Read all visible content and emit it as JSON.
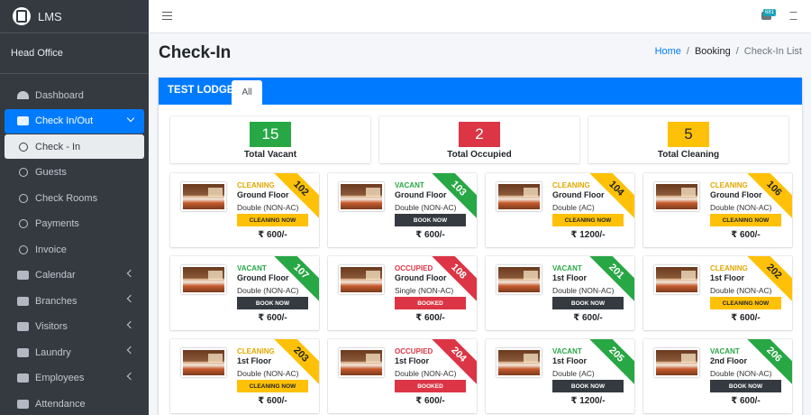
{
  "brand": {
    "name": "LMS"
  },
  "user": {
    "name": "Head Office"
  },
  "nav": [
    {
      "label": "Dashboard",
      "icon": "dashboard-icon",
      "kind": "dash",
      "chevron": false,
      "state": ""
    },
    {
      "label": "Check In/Out",
      "icon": "cart-icon",
      "kind": "cart",
      "chevron": true,
      "state": "active"
    },
    {
      "label": "Check - In",
      "icon": "circle-icon",
      "kind": "circle",
      "chevron": false,
      "state": "sub-active"
    },
    {
      "label": "Guests",
      "icon": "circle-icon",
      "kind": "circle",
      "chevron": false,
      "state": ""
    },
    {
      "label": "Check Rooms",
      "icon": "circle-icon",
      "kind": "circle",
      "chevron": false,
      "state": ""
    },
    {
      "label": "Payments",
      "icon": "circle-icon",
      "kind": "circle",
      "chevron": false,
      "state": ""
    },
    {
      "label": "Invoice",
      "icon": "circle-icon",
      "kind": "circle",
      "chevron": false,
      "state": ""
    },
    {
      "label": "Calendar",
      "icon": "calendar-icon",
      "kind": "box",
      "chevron": true,
      "state": ""
    },
    {
      "label": "Branches",
      "icon": "briefcase-icon",
      "kind": "box",
      "chevron": true,
      "state": ""
    },
    {
      "label": "Visitors",
      "icon": "edit-icon",
      "kind": "box",
      "chevron": true,
      "state": ""
    },
    {
      "label": "Laundry",
      "icon": "list-icon",
      "kind": "box",
      "chevron": true,
      "state": ""
    },
    {
      "label": "Employees",
      "icon": "users-icon",
      "kind": "box",
      "chevron": true,
      "state": ""
    },
    {
      "label": "Attendance",
      "icon": "clock-icon",
      "kind": "box",
      "chevron": false,
      "state": ""
    }
  ],
  "topbar": {
    "badge": "681"
  },
  "page": {
    "title": "Check-In"
  },
  "breadcrumb": {
    "home": "Home",
    "mid": "Booking",
    "current": "Check-In List"
  },
  "lodge": {
    "name": "TEST LODGE",
    "tab": "All"
  },
  "colors": {
    "vacant": "#28a745",
    "occupied": "#dc3545",
    "cleaning": "#ffc107",
    "dark": "#343a40"
  },
  "stats": [
    {
      "value": "15",
      "label": "Total Vacant",
      "color": "#28a745"
    },
    {
      "value": "2",
      "label": "Total Occupied",
      "color": "#dc3545"
    },
    {
      "value": "5",
      "label": "Total Cleaning",
      "color": "#ffc107"
    }
  ],
  "rooms": [
    {
      "number": "102",
      "status": "CLEANING",
      "floor": "Ground Floor",
      "type": "Double (NON-AC)",
      "action": "CLEANING NOW",
      "price": "₹ 600/-"
    },
    {
      "number": "103",
      "status": "VACANT",
      "floor": "Ground Floor",
      "type": "Double (NON-AC)",
      "action": "BOOK NOW",
      "price": "₹ 600/-"
    },
    {
      "number": "104",
      "status": "CLEANING",
      "floor": "Ground Floor",
      "type": "Double (AC)",
      "action": "CLEANING NOW",
      "price": "₹ 1200/-"
    },
    {
      "number": "106",
      "status": "CLEANING",
      "floor": "Ground Floor",
      "type": "Double (NON-AC)",
      "action": "CLEANING NOW",
      "price": "₹ 600/-"
    },
    {
      "number": "107",
      "status": "VACANT",
      "floor": "Ground Floor",
      "type": "Double (NON-AC)",
      "action": "BOOK NOW",
      "price": "₹ 600/-"
    },
    {
      "number": "108",
      "status": "OCCUPIED",
      "floor": "Ground Floor",
      "type": "Single (NON-AC)",
      "action": "BOOKED",
      "price": "₹ 600/-"
    },
    {
      "number": "201",
      "status": "VACANT",
      "floor": "1st Floor",
      "type": "Double (NON-AC)",
      "action": "BOOK NOW",
      "price": "₹ 600/-"
    },
    {
      "number": "202",
      "status": "CLEANING",
      "floor": "1st Floor",
      "type": "Double (NON-AC)",
      "action": "CLEANING NOW",
      "price": "₹ 600/-"
    },
    {
      "number": "203",
      "status": "CLEANING",
      "floor": "1st Floor",
      "type": "Double (NON-AC)",
      "action": "CLEANING NOW",
      "price": "₹ 600/-"
    },
    {
      "number": "204",
      "status": "OCCUPIED",
      "floor": "1st Floor",
      "type": "Double (NON-AC)",
      "action": "BOOKED",
      "price": "₹ 600/-"
    },
    {
      "number": "205",
      "status": "VACANT",
      "floor": "1st Floor",
      "type": "Double (AC)",
      "action": "BOOK NOW",
      "price": "₹ 1200/-"
    },
    {
      "number": "206",
      "status": "VACANT",
      "floor": "2nd Floor",
      "type": "Double (NON-AC)",
      "action": "BOOK NOW",
      "price": "₹ 600/-"
    }
  ]
}
